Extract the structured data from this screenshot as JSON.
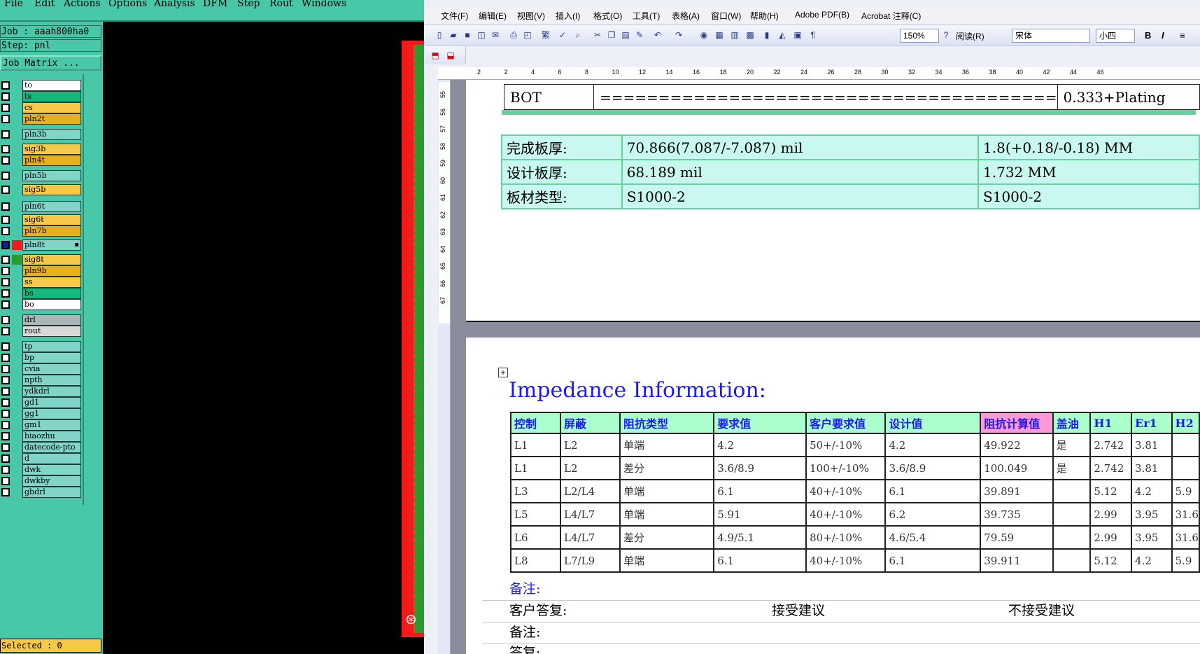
{
  "cam_app": {
    "menu": [
      "File",
      "Edit",
      "Actions",
      "Options",
      "Analysis",
      "DFM",
      "Step",
      "Rout",
      "Windows"
    ],
    "job_label": "Job : aaah800ha0",
    "step_label": "Step: pnl",
    "job_matrix_label": "Job Matrix ...",
    "selected_label": "Selected : 0",
    "layers": [
      {
        "name": "to",
        "color": "#ffffff"
      },
      {
        "name": "ts",
        "color": "#14b87a"
      },
      {
        "name": "cs",
        "color": "#f8c848"
      },
      {
        "name": "pln2t",
        "color": "#e8b020"
      },
      {
        "name": "pln3b",
        "color": "#80d4c8"
      },
      {
        "name": "sig3b",
        "color": "#f8c848"
      },
      {
        "name": "pln4t",
        "color": "#e8b020"
      },
      {
        "name": "pln5b",
        "color": "#80d4c8"
      },
      {
        "name": "sig5b",
        "color": "#f8c848"
      },
      {
        "name": "pln6t",
        "color": "#80d4c8"
      },
      {
        "name": "sig6t",
        "color": "#f8c848"
      },
      {
        "name": "pln7b",
        "color": "#e8b020"
      },
      {
        "name": "pln8t",
        "color": "#80d4c8",
        "active": true,
        "swatch": "#f21a1a"
      },
      {
        "name": "sig8t",
        "color": "#f8c848",
        "swatch": "#2a9a30"
      },
      {
        "name": "pln9b",
        "color": "#e8b020"
      },
      {
        "name": "ss",
        "color": "#f8c848"
      },
      {
        "name": "bs",
        "color": "#14b87a"
      },
      {
        "name": "bo",
        "color": "#ffffff"
      },
      {
        "name": "drl",
        "color": "#a8b8b8"
      },
      {
        "name": "rout",
        "color": "#d8d8d8"
      },
      {
        "name": "tp",
        "color": "#80d4c8"
      },
      {
        "name": "bp",
        "color": "#80d4c8"
      },
      {
        "name": "cvia",
        "color": "#80d4c8"
      },
      {
        "name": "npth",
        "color": "#80d4c8"
      },
      {
        "name": "ydkdrl",
        "color": "#80d4c8"
      },
      {
        "name": "gd1",
        "color": "#80d4c8"
      },
      {
        "name": "gg1",
        "color": "#80d4c8"
      },
      {
        "name": "gm1",
        "color": "#80d4c8"
      },
      {
        "name": "biaozhu",
        "color": "#80d4c8"
      },
      {
        "name": "datecode-pto",
        "color": "#80d4c8"
      },
      {
        "name": "d",
        "color": "#80d4c8"
      },
      {
        "name": "dwk",
        "color": "#80d4c8"
      },
      {
        "name": "dwkby",
        "color": "#80d4c8"
      },
      {
        "name": "gbdrl",
        "color": "#80d4c8"
      }
    ]
  },
  "word": {
    "menu": [
      "文件(F)",
      "编辑(E)",
      "视图(V)",
      "插入(I)",
      "格式(O)",
      "工具(T)",
      "表格(A)",
      "窗口(W)",
      "帮助(H)",
      "Adobe PDF(B)",
      "Acrobat 注释(C)"
    ],
    "zoom": "150%",
    "read_label": "阅读(R)",
    "font_name": "宋体",
    "font_size": "小四",
    "ruler_ticks": [
      "2",
      "2",
      "4",
      "6",
      "8",
      "10",
      "12",
      "14",
      "16",
      "18",
      "20",
      "22",
      "24",
      "26",
      "28",
      "30",
      "32",
      "34",
      "36",
      "38",
      "40",
      "42",
      "44",
      "46"
    ],
    "vruler_ticks": [
      "55",
      "56",
      "57",
      "58",
      "59",
      "60",
      "61",
      "62",
      "63",
      "64",
      "65",
      "66",
      "67"
    ],
    "bot_row": [
      "BOT",
      "=======================================",
      "0.333+Plating"
    ],
    "thickness_rows": [
      [
        "完成板厚:",
        "70.866(7.087/-7.087) mil",
        "1.8(+0.18/-0.18) MM"
      ],
      [
        "设计板厚:",
        "68.189 mil",
        "1.732 MM"
      ],
      [
        "板材类型:",
        "S1000-2",
        "S1000-2"
      ]
    ],
    "impedance_title": "Impedance Information:",
    "impedance_headers": [
      "控制",
      "屏蔽",
      "阻抗类型",
      "要求值",
      "客户要求值",
      "设计值",
      "阻抗计算值",
      "盖油",
      "H1",
      "Er1",
      "H2"
    ],
    "impedance_rows": [
      [
        "L1",
        "L2",
        "单端",
        "4.2",
        "50+/-10%",
        "4.2",
        "49.922",
        "是",
        "2.742",
        "3.81",
        ""
      ],
      [
        "L1",
        "L2",
        "差分",
        "3.6/8.9",
        "100+/-10%",
        "3.6/8.9",
        "100.049",
        "是",
        "2.742",
        "3.81",
        ""
      ],
      [
        "L3",
        "L2/L4",
        "单端",
        "6.1",
        "40+/-10%",
        "6.1",
        "39.891",
        "",
        "5.12",
        "4.2",
        "5.9"
      ],
      [
        "L5",
        "L4/L7",
        "单端",
        "5.91",
        "40+/-10%",
        "6.2",
        "39.735",
        "",
        "2.99",
        "3.95",
        "31.6"
      ],
      [
        "L6",
        "L4/L7",
        "差分",
        "4.9/5.1",
        "80+/-10%",
        "4.6/5.4",
        "79.59",
        "",
        "2.99",
        "3.95",
        "31.6"
      ],
      [
        "L8",
        "L7/L9",
        "单端",
        "6.1",
        "40+/-10%",
        "6.1",
        "39.911",
        "",
        "5.12",
        "4.2",
        "5.9"
      ]
    ],
    "note1": "备注:",
    "customer_reply_label": "客户答复:",
    "accept_label": "接受建议",
    "reject_label": "不接受建议",
    "note2": "备注:",
    "reply_label": "答复:"
  }
}
